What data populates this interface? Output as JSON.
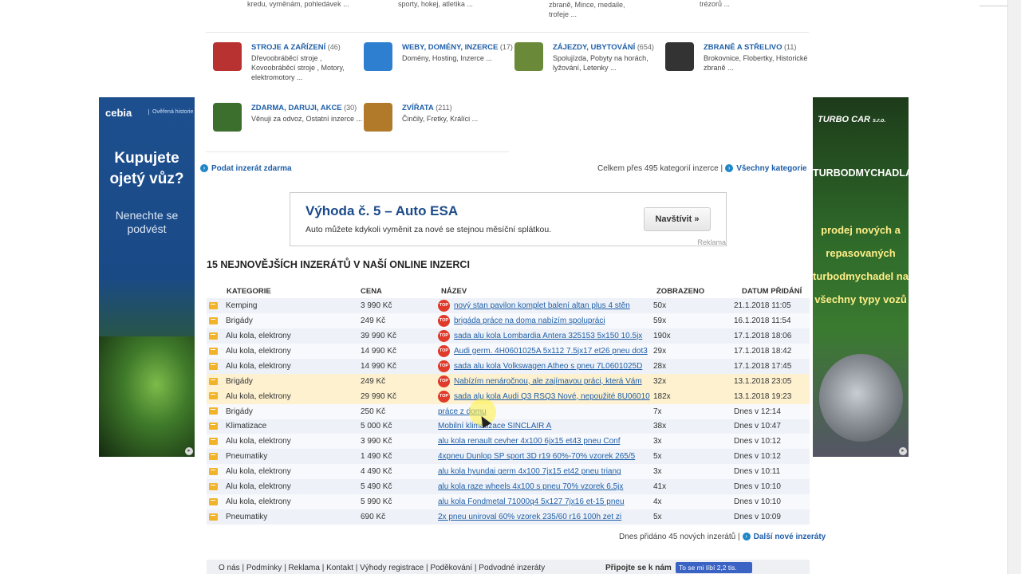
{
  "top_fragments": [
    "kredu, vyměnám, pohledávek ...",
    "sporty, hokej, atletika ...",
    "zbraně, Mince, medaile, trofeje ...",
    "trézorů ..."
  ],
  "categories": [
    {
      "title": "STROJE A ZAŘÍZENÍ",
      "count": "(46)",
      "sub": "Dřevoobráběcí stroje , Kovoobráběcí stroje , Motory, elektromotory ...",
      "icon": "tractor-icon",
      "color": "#b83232"
    },
    {
      "title": "WEBY, DOMÉNY, INZERCE",
      "count": "(17)",
      "sub": "Domény, Hosting, Inzerce ...",
      "icon": "web-info-icon",
      "color": "#2f7fd1"
    },
    {
      "title": "ZÁJEZDY, UBYTOVÁNÍ",
      "count": "(654)",
      "sub": "Spolujízda, Pobyty na horách, lyžování, Letenky ...",
      "icon": "palm-icon",
      "color": "#6a8a3a"
    },
    {
      "title": "ZBRANĚ A STŘELIVO",
      "count": "(11)",
      "sub": "Brokovnice, Flobertky, Historické zbraně ...",
      "icon": "pistol-icon",
      "color": "#333333"
    },
    {
      "title": "ZDARMA, DARUJI, AKCE",
      "count": "(30)",
      "sub": "Věnuji za odvoz, Ostatní inzerce ...",
      "icon": "free-sign-icon",
      "color": "#3c6e2e"
    },
    {
      "title": "ZVÍŘATA",
      "count": "(211)",
      "sub": "Činčily, Fretky, Králíci ...",
      "icon": "dog-icon",
      "color": "#b07a2a"
    }
  ],
  "actions": {
    "post_ad": "Podat inzerát zdarma",
    "total_text": "Celkem přes 495 kategorií inzerce |",
    "all_categories": "Všechny kategorie"
  },
  "ad_left": {
    "brand": "cebia",
    "brand_sub": "Ověřená historie",
    "headline": "Kupujete ojetý vůz?",
    "subline": "Nenechte se podvést"
  },
  "ad_right": {
    "brand": "TURBO CAR",
    "brand_suffix": "s.r.o.",
    "headline": "TURBODMYCHADLA",
    "subline": "prodej nových a repasovaných turbodmychadel na všechny typy vozů"
  },
  "banner": {
    "title": "Výhoda č. 5 – Auto ESA",
    "desc": "Auto můžete kdykoli vyměnit za nové se stejnou měsíční splátkou.",
    "button": "Navštívit »",
    "label": "Reklama"
  },
  "section_title": "15 NEJNOVĚJŠÍCH INZERÁTŮ V NAŠÍ ONLINE INZERCI",
  "table": {
    "headers": {
      "category": "KATEGORIE",
      "price": "CENA",
      "name": "NÁZEV",
      "views": "ZOBRAZENO",
      "date": "DATUM PŘIDÁNÍ"
    },
    "top_label": "TOP",
    "rows": [
      {
        "category": "Kemping",
        "price": "3 990 Kč",
        "top": true,
        "hl": false,
        "name": "nový stan pavilon komplet balení altan plus 4 stěn",
        "views": "50x",
        "date": "21.1.2018 11:05"
      },
      {
        "category": "Brigády",
        "price": "249 Kč",
        "top": true,
        "hl": false,
        "name": "brigáda práce na doma nabízím spolupráci",
        "views": "59x",
        "date": "16.1.2018 11:54"
      },
      {
        "category": "Alu kola, elektrony",
        "price": "39 990 Kč",
        "top": true,
        "hl": false,
        "name": "sada alu kola Lombardia Antera 325153 5x150 10.5jx",
        "views": "190x",
        "date": "17.1.2018 18:06"
      },
      {
        "category": "Alu kola, elektrony",
        "price": "14 990 Kč",
        "top": true,
        "hl": false,
        "name": "Audi germ. 4H0601025A 5x112 7.5jx17 et26 pneu dot3",
        "views": "29x",
        "date": "17.1.2018 18:42"
      },
      {
        "category": "Alu kola, elektrony",
        "price": "14 990 Kč",
        "top": true,
        "hl": false,
        "name": "sada alu kola Volkswagen Atheo s pneu 7L0601025D",
        "views": "28x",
        "date": "17.1.2018 17:45"
      },
      {
        "category": "Brigády",
        "price": "249 Kč",
        "top": true,
        "hl": true,
        "name": "Nabízím nenáročnou, ale zajímavou práci, která Vám",
        "views": "32x",
        "date": "13.1.2018 23:05"
      },
      {
        "category": "Alu kola, elektrony",
        "price": "29 990 Kč",
        "top": true,
        "hl": true,
        "name": "sada alu kola Audi Q3 RSQ3 Nové, nepoužité 8U06010",
        "views": "182x",
        "date": "13.1.2018 19:23"
      },
      {
        "category": "Brigády",
        "price": "250 Kč",
        "top": false,
        "hl": false,
        "name": "práce z domu",
        "views": "7x",
        "date": "Dnes v 12:14"
      },
      {
        "category": "Klimatizace",
        "price": "5 000 Kč",
        "top": false,
        "hl": false,
        "name": "Mobilní klimatizace SINCLAIR A",
        "views": "38x",
        "date": "Dnes v 10:47"
      },
      {
        "category": "Alu kola, elektrony",
        "price": "3 990 Kč",
        "top": false,
        "hl": false,
        "name": "alu kola renault cevher 4x100 6jx15 et43 pneu Conf",
        "views": "3x",
        "date": "Dnes v 10:12"
      },
      {
        "category": "Pneumatiky",
        "price": "1 490 Kč",
        "top": false,
        "hl": false,
        "name": "4xpneu Dunlop SP sport 3D r19 60%-70% vzorek 265/5",
        "views": "5x",
        "date": "Dnes v 10:12"
      },
      {
        "category": "Alu kola, elektrony",
        "price": "4 490 Kč",
        "top": false,
        "hl": false,
        "name": "alu kola hyundai germ 4x100 7jx15 et42 pneu triang",
        "views": "3x",
        "date": "Dnes v 10:11"
      },
      {
        "category": "Alu kola, elektrony",
        "price": "5 490 Kč",
        "top": false,
        "hl": false,
        "name": "alu kola raze wheels 4x100 s pneu 70% vzorek 6.5jx",
        "views": "41x",
        "date": "Dnes v 10:10"
      },
      {
        "category": "Alu kola, elektrony",
        "price": "5 990 Kč",
        "top": false,
        "hl": false,
        "name": "alu kola Fondmetal 71000q4 5x127 7jx16 et-15 pneu",
        "views": "4x",
        "date": "Dnes v 10:10"
      },
      {
        "category": "Pneumatiky",
        "price": "690 Kč",
        "top": false,
        "hl": false,
        "name": "2x pneu uniroval 60% vzorek 235/60 r16 100h zet zi",
        "views": "5x",
        "date": "Dnes v 10:09"
      }
    ]
  },
  "today_text": "Dnes přidáno 45 nových inzerátů |",
  "more_link": "Další nové inzeráty",
  "footer": {
    "links": "O nás | Podmínky | Reklama | Kontakt | Výhody registrace | Poděkování | Podvodné inzeráty",
    "follow": "Připojte se k nám",
    "fb_button": "To se mi líbí 2,2 tis."
  }
}
